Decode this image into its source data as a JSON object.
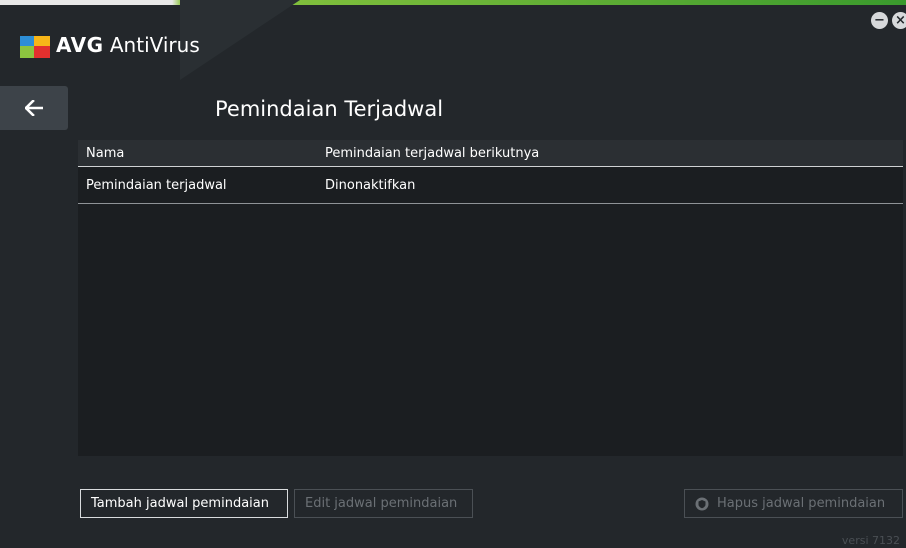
{
  "app": {
    "brand": "AVG",
    "product": "AntiVirus",
    "minimize_symbol": "−",
    "close_symbol": "×"
  },
  "page": {
    "title": "Pemindaian Terjadwal",
    "back_icon": "arrow-left-icon"
  },
  "table": {
    "columns": [
      "Nama",
      "Pemindaian terjadwal berikutnya"
    ],
    "rows": [
      [
        "Pemindaian terjadwal",
        "Dinonaktifkan"
      ]
    ]
  },
  "buttons": {
    "add": "Tambah jadwal pemindaian",
    "edit": "Edit jadwal pemindaian",
    "delete": "Hapus jadwal pemindaian"
  },
  "footer": {
    "version": "versi 7132"
  },
  "colors": {
    "background": "#23272b",
    "panel": "#1b1e21",
    "accent_green": "#3a9a2d"
  }
}
